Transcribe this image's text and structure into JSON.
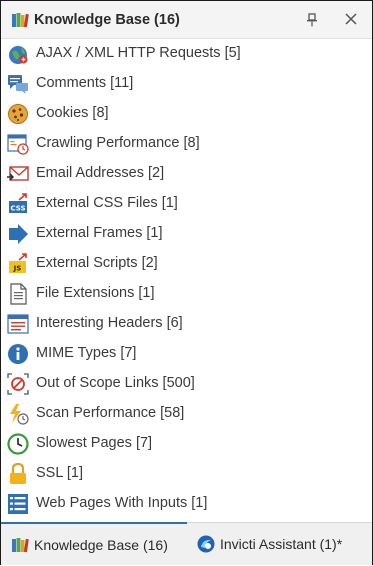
{
  "panel": {
    "title": "Knowledge Base (16)"
  },
  "items": [
    {
      "label": "AJAX / XML HTTP Requests [5]",
      "icon": "ajax-globe-icon"
    },
    {
      "label": "Comments [11]",
      "icon": "comments-icon"
    },
    {
      "label": "Cookies [8]",
      "icon": "cookie-icon"
    },
    {
      "label": "Crawling Performance [8]",
      "icon": "crawling-performance-icon"
    },
    {
      "label": "Email Addresses [2]",
      "icon": "email-icon"
    },
    {
      "label": "External CSS Files [1]",
      "icon": "css-file-icon"
    },
    {
      "label": "External Frames [1]",
      "icon": "frame-arrow-icon"
    },
    {
      "label": "External Scripts [2]",
      "icon": "js-file-icon"
    },
    {
      "label": "File Extensions [1]",
      "icon": "file-icon"
    },
    {
      "label": "Interesting Headers [6]",
      "icon": "headers-icon"
    },
    {
      "label": "MIME Types [7]",
      "icon": "info-icon"
    },
    {
      "label": "Out of Scope Links [500]",
      "icon": "out-of-scope-icon"
    },
    {
      "label": "Scan Performance [58]",
      "icon": "scan-performance-icon"
    },
    {
      "label": "Slowest Pages [7]",
      "icon": "clock-icon"
    },
    {
      "label": "SSL [1]",
      "icon": "lock-icon"
    },
    {
      "label": "Web Pages With Inputs [1]",
      "icon": "form-inputs-icon"
    }
  ],
  "tabs": {
    "knowledge_base": "Knowledge Base (16)",
    "invicti_assistant": "Invicti Assistant (1)*"
  },
  "colors": {
    "accent": "#2f6fb3",
    "text": "#3a3a3a",
    "titlebar_bg": "#f4f4f4"
  }
}
